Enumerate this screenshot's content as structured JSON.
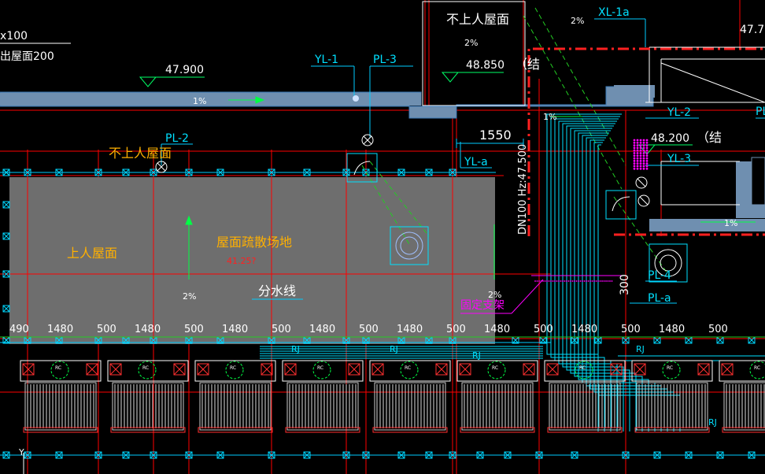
{
  "texts": {
    "roof_top_left": "x100",
    "roof_top_left2": "出屋面200",
    "elev_47900": "47.900",
    "elev_48850": "48.850",
    "elev_48200": "48.200",
    "elev_477": "47.7",
    "elev_4125": "41.25?",
    "yl1": "YL-1",
    "pl3": "PL-3",
    "pl2": "PL-2",
    "yla": "YL-a",
    "yl2": "YL-2",
    "yl3": "YL-3",
    "xl1a": "XL-1a",
    "pl4": "PL-4",
    "pla": "PL-a",
    "pl_right": "PL",
    "no_access_roof_top": "不上人屋面",
    "no_access_roof_left": "不上人屋面",
    "access_roof": "上人屋面",
    "evac_area": "屋面疏散场地",
    "water_divide": "分水线",
    "support_rack": "固定支架",
    "structure1": "（结",
    "structure2": "（结",
    "dn_label": "DN100 Hz:47.500",
    "dim_1550": "1550",
    "dim_300": "300",
    "slope_1": "1%",
    "slope_2": "2%",
    "rj": "RJ",
    "rc": "RC"
  },
  "dim_row": [
    "490",
    "1480",
    "500",
    "1480",
    "500",
    "1480",
    "500",
    "1480",
    "500",
    "1480",
    "500",
    "1480",
    "500",
    "1480",
    "500",
    "1480",
    "500"
  ],
  "colors": {
    "background": "#000000",
    "grid_red": "#ff0000",
    "pipe_cyan": "#00ffff",
    "text_orange": "#ffb000",
    "text_cyan": "#7fffd4",
    "slab_fill": "#6e6e6e",
    "roof_band": "#6f8fb0",
    "magenta": "#ff00ff",
    "green": "#00ff00"
  }
}
